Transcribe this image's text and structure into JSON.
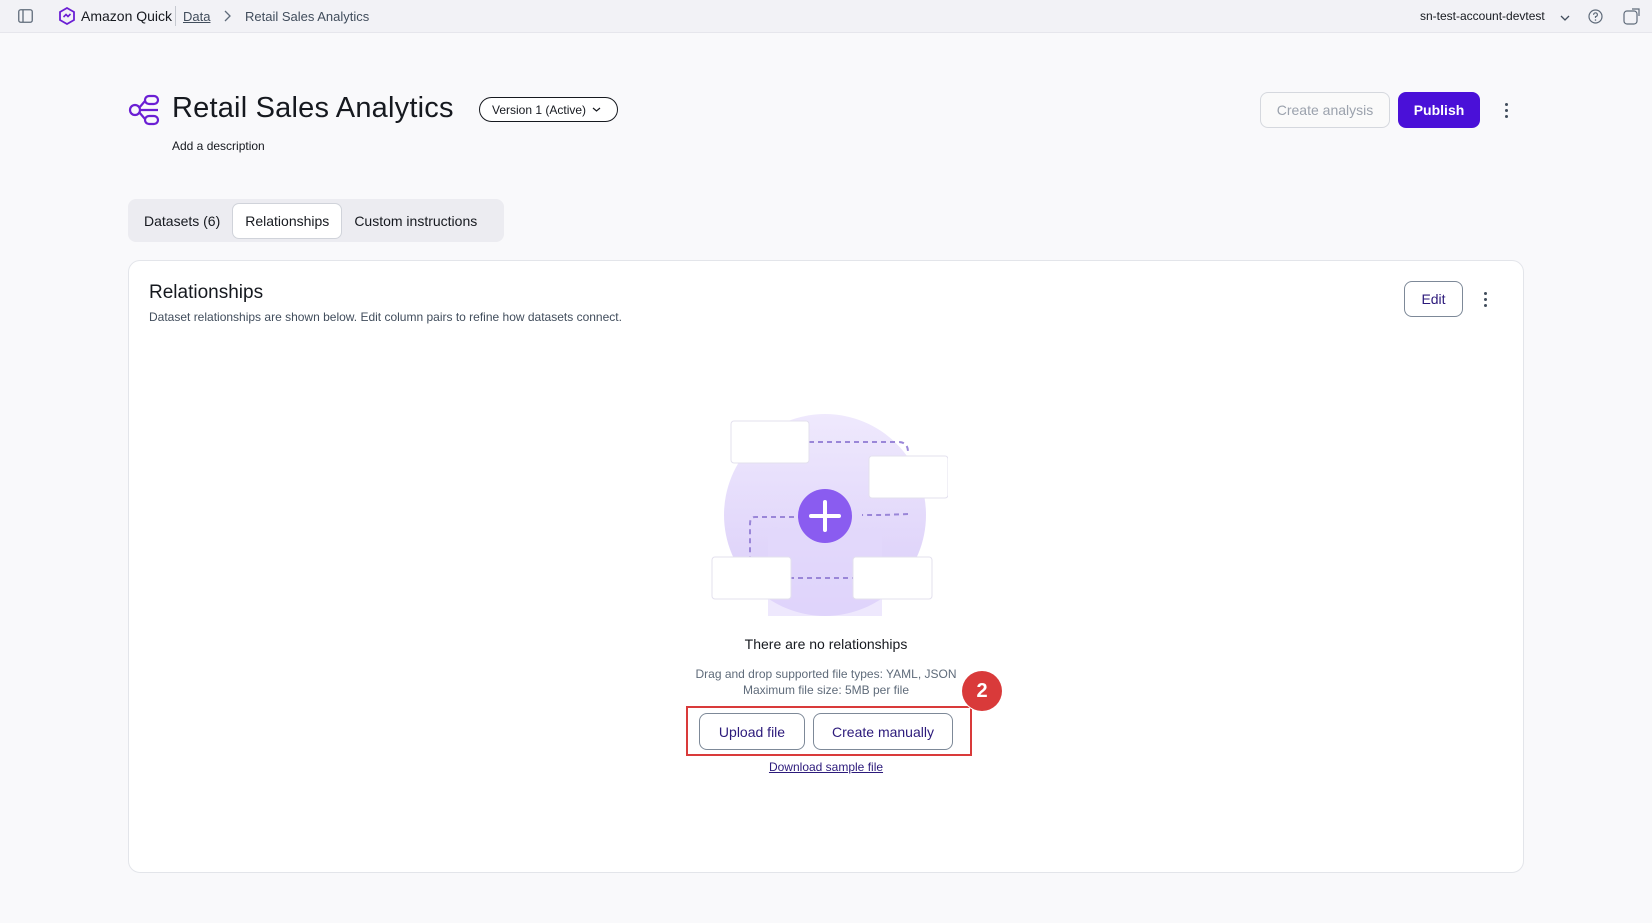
{
  "topbar": {
    "app_name": "Amazon Quick",
    "breadcrumb": [
      "Data",
      "Retail Sales Analytics"
    ],
    "account": "sn-test-account-devtest"
  },
  "header": {
    "title": "Retail Sales Analytics",
    "description": "Add a description",
    "version": "Version 1 (Active)",
    "create_analysis": "Create analysis",
    "publish": "Publish"
  },
  "tabs": [
    {
      "label": "Datasets (6)",
      "active": false
    },
    {
      "label": "Relationships",
      "active": true
    },
    {
      "label": "Custom instructions",
      "active": false
    }
  ],
  "panel": {
    "title": "Relationships",
    "subtitle": "Dataset relationships are shown below. Edit column pairs to refine how datasets connect.",
    "edit": "Edit",
    "empty_title": "There are no relationships",
    "file_types": "Drag and drop supported file types: YAML, JSON",
    "max_size": "Maximum file size: 5MB per file",
    "upload": "Upload file",
    "create_manually": "Create manually",
    "download_sample": "Download sample file"
  },
  "annotation": {
    "step": "2",
    "color": "#d93a3a"
  },
  "colors": {
    "accent": "#4a10d8",
    "illustration": "#e4dcfb",
    "plus": "#8a5cf0"
  }
}
